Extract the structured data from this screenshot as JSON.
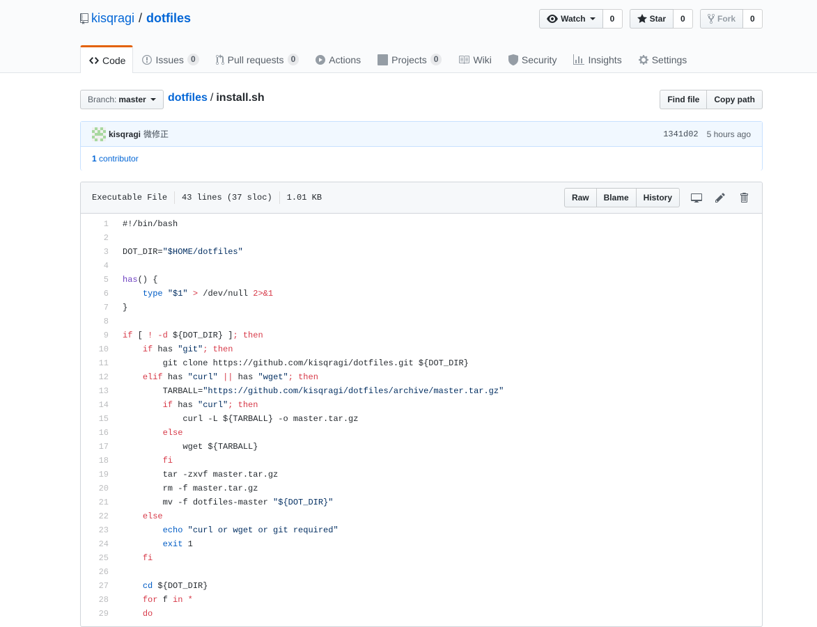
{
  "repo": {
    "owner": "kisqragi",
    "name": "dotfiles"
  },
  "actions": {
    "watch": {
      "label": "Watch",
      "count": "0"
    },
    "star": {
      "label": "Star",
      "count": "0"
    },
    "fork": {
      "label": "Fork",
      "count": "0"
    }
  },
  "tabs": [
    {
      "label": "Code",
      "icon": "code-icon",
      "selected": true
    },
    {
      "label": "Issues",
      "icon": "issue-icon",
      "count": "0"
    },
    {
      "label": "Pull requests",
      "icon": "pull-request-icon",
      "count": "0"
    },
    {
      "label": "Actions",
      "icon": "play-icon"
    },
    {
      "label": "Projects",
      "icon": "project-icon",
      "count": "0"
    },
    {
      "label": "Wiki",
      "icon": "book-icon"
    },
    {
      "label": "Security",
      "icon": "shield-icon"
    },
    {
      "label": "Insights",
      "icon": "graph-icon"
    },
    {
      "label": "Settings",
      "icon": "gear-icon"
    }
  ],
  "branch": {
    "label": "Branch:",
    "value": "master"
  },
  "breadcrumb": {
    "root": "dotfiles",
    "separator": "/",
    "file": "install.sh"
  },
  "file_nav": {
    "find_file": "Find file",
    "copy_path": "Copy path"
  },
  "commit": {
    "author": "kisqragi",
    "message": "微修正",
    "sha": "1341d02",
    "time": "5 hours ago",
    "contributors_count": "1",
    "contributors_label": "contributor"
  },
  "file": {
    "mode": "Executable File",
    "lines_info": "43 lines (37 sloc)",
    "size": "1.01 KB",
    "raw": "Raw",
    "blame": "Blame",
    "history": "History"
  },
  "colors": {
    "link": "#0366d6",
    "keyword": "#d73a49",
    "string": "#032f62",
    "function": "#6f42c1",
    "builtin": "#005cc5",
    "selected_tab": "#e36209"
  },
  "code_lines": [
    {
      "n": "1",
      "tokens": [
        [
          "",
          "#!/bin/bash"
        ]
      ]
    },
    {
      "n": "2",
      "tokens": []
    },
    {
      "n": "3",
      "tokens": [
        [
          "",
          "DOT_DIR="
        ],
        [
          "str",
          "\"$HOME/dotfiles\""
        ]
      ]
    },
    {
      "n": "4",
      "tokens": []
    },
    {
      "n": "5",
      "tokens": [
        [
          "fn",
          "has"
        ],
        [
          "",
          "() {"
        ]
      ]
    },
    {
      "n": "6",
      "tokens": [
        [
          "",
          "    "
        ],
        [
          "bi",
          "type"
        ],
        [
          "",
          " "
        ],
        [
          "str",
          "\"$1\""
        ],
        [
          "",
          " "
        ],
        [
          "kw",
          ">"
        ],
        [
          "",
          " /dev/null "
        ],
        [
          "kw",
          "2>&1"
        ]
      ]
    },
    {
      "n": "7",
      "tokens": [
        [
          "",
          "}"
        ]
      ]
    },
    {
      "n": "8",
      "tokens": []
    },
    {
      "n": "9",
      "tokens": [
        [
          "kw",
          "if"
        ],
        [
          "",
          " [ "
        ],
        [
          "kw",
          "!"
        ],
        [
          "",
          " "
        ],
        [
          "kw",
          "-d"
        ],
        [
          "",
          " ${DOT_DIR} ]"
        ],
        [
          "kw",
          "; then"
        ]
      ]
    },
    {
      "n": "10",
      "tokens": [
        [
          "",
          "    "
        ],
        [
          "kw",
          "if"
        ],
        [
          "",
          " has "
        ],
        [
          "str",
          "\"git\""
        ],
        [
          "kw",
          "; then"
        ]
      ]
    },
    {
      "n": "11",
      "tokens": [
        [
          "",
          "        git clone https://github.com/kisqragi/dotfiles.git ${DOT_DIR}"
        ]
      ]
    },
    {
      "n": "12",
      "tokens": [
        [
          "",
          "    "
        ],
        [
          "kw",
          "elif"
        ],
        [
          "",
          " has "
        ],
        [
          "str",
          "\"curl\""
        ],
        [
          "",
          " "
        ],
        [
          "kw",
          "||"
        ],
        [
          "",
          " has "
        ],
        [
          "str",
          "\"wget\""
        ],
        [
          "kw",
          "; then"
        ]
      ]
    },
    {
      "n": "13",
      "tokens": [
        [
          "",
          "        TARBALL="
        ],
        [
          "str",
          "\"https://github.com/kisqragi/dotfiles/archive/master.tar.gz\""
        ]
      ]
    },
    {
      "n": "14",
      "tokens": [
        [
          "",
          "        "
        ],
        [
          "kw",
          "if"
        ],
        [
          "",
          " has "
        ],
        [
          "str",
          "\"curl\""
        ],
        [
          "kw",
          "; then"
        ]
      ]
    },
    {
      "n": "15",
      "tokens": [
        [
          "",
          "            curl -L ${TARBALL} -o master.tar.gz"
        ]
      ]
    },
    {
      "n": "16",
      "tokens": [
        [
          "",
          "        "
        ],
        [
          "kw",
          "else"
        ]
      ]
    },
    {
      "n": "17",
      "tokens": [
        [
          "",
          "            wget ${TARBALL}"
        ]
      ]
    },
    {
      "n": "18",
      "tokens": [
        [
          "",
          "        "
        ],
        [
          "kw",
          "fi"
        ]
      ]
    },
    {
      "n": "19",
      "tokens": [
        [
          "",
          "        tar -zxvf master.tar.gz"
        ]
      ]
    },
    {
      "n": "20",
      "tokens": [
        [
          "",
          "        rm -f master.tar.gz"
        ]
      ]
    },
    {
      "n": "21",
      "tokens": [
        [
          "",
          "        mv -f dotfiles-master "
        ],
        [
          "str",
          "\"${DOT_DIR}\""
        ]
      ]
    },
    {
      "n": "22",
      "tokens": [
        [
          "",
          "    "
        ],
        [
          "kw",
          "else"
        ]
      ]
    },
    {
      "n": "23",
      "tokens": [
        [
          "",
          "        "
        ],
        [
          "bi",
          "echo"
        ],
        [
          "",
          " "
        ],
        [
          "str",
          "\"curl or wget or git required\""
        ]
      ]
    },
    {
      "n": "24",
      "tokens": [
        [
          "",
          "        "
        ],
        [
          "bi",
          "exit"
        ],
        [
          "",
          " 1"
        ]
      ]
    },
    {
      "n": "25",
      "tokens": [
        [
          "",
          "    "
        ],
        [
          "kw",
          "fi"
        ]
      ]
    },
    {
      "n": "26",
      "tokens": []
    },
    {
      "n": "27",
      "tokens": [
        [
          "",
          "    "
        ],
        [
          "bi",
          "cd"
        ],
        [
          "",
          " ${DOT_DIR}"
        ]
      ]
    },
    {
      "n": "28",
      "tokens": [
        [
          "",
          "    "
        ],
        [
          "kw",
          "for"
        ],
        [
          "",
          " f "
        ],
        [
          "kw",
          "in"
        ],
        [
          "",
          " "
        ],
        [
          "kw",
          "*"
        ]
      ]
    },
    {
      "n": "29",
      "tokens": [
        [
          "",
          "    "
        ],
        [
          "kw",
          "do"
        ]
      ]
    }
  ]
}
